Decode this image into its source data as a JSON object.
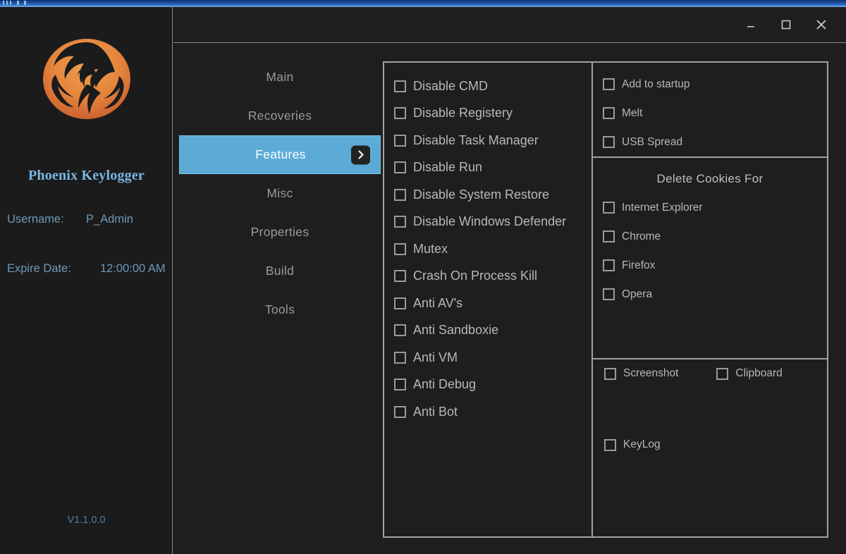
{
  "window": {
    "controls": [
      {
        "name": "minimize",
        "glyph": "minimize-icon"
      },
      {
        "name": "maximize",
        "glyph": "maximize-icon"
      },
      {
        "name": "close",
        "glyph": "close-icon"
      }
    ]
  },
  "sidebar": {
    "logo_alt": "phoenix-logo",
    "brand": "Phoenix Keylogger",
    "username_label": "Username:",
    "username_value": "P_Admin",
    "expire_label": "Expire Date:",
    "expire_value": "12:00:00 AM",
    "version": "V1.1.0.0"
  },
  "nav": {
    "items": [
      {
        "label": "Main",
        "active": false
      },
      {
        "label": "Recoveries",
        "active": false
      },
      {
        "label": "Features",
        "active": true
      },
      {
        "label": "Misc",
        "active": false
      },
      {
        "label": "Properties",
        "active": false
      },
      {
        "label": "Build",
        "active": false
      },
      {
        "label": "Tools",
        "active": false
      }
    ],
    "active_index": 2,
    "chevron_icon": "chevron-right-icon"
  },
  "features": {
    "left_column": [
      {
        "label": "Disable CMD",
        "checked": false
      },
      {
        "label": "Disable Registery",
        "checked": false
      },
      {
        "label": "Disable Task Manager",
        "checked": false
      },
      {
        "label": "Disable Run",
        "checked": false
      },
      {
        "label": "Disable System Restore",
        "checked": false
      },
      {
        "label": "Disable Windows Defender",
        "checked": false
      },
      {
        "label": "Mutex",
        "checked": false
      },
      {
        "label": "Crash On Process Kill",
        "checked": false
      },
      {
        "label": "Anti AV's",
        "checked": false
      },
      {
        "label": "Anti Sandboxie",
        "checked": false
      },
      {
        "label": "Anti VM",
        "checked": false
      },
      {
        "label": "Anti Debug",
        "checked": false
      },
      {
        "label": "Anti Bot",
        "checked": false
      }
    ],
    "startup_group": [
      {
        "label": "Add to startup",
        "checked": false
      },
      {
        "label": "Melt",
        "checked": false
      },
      {
        "label": "USB Spread",
        "checked": false
      }
    ],
    "cookies_title": "Delete Cookies For",
    "cookies_group": [
      {
        "label": "Internet Explorer",
        "checked": false
      },
      {
        "label": "Chrome",
        "checked": false
      },
      {
        "label": "Firefox",
        "checked": false
      },
      {
        "label": "Opera",
        "checked": false
      }
    ],
    "capture_group": [
      {
        "label": "Screenshot",
        "checked": false
      },
      {
        "label": "Clipboard",
        "checked": false
      }
    ],
    "keylog": {
      "label": "KeyLog",
      "checked": false
    }
  },
  "colors": {
    "accent_blue": "#5cabd7",
    "brand_text": "#79b8e0",
    "info_text": "#6d98b8",
    "panel_border": "#a2a2a2",
    "bg_dark": "#1e1e1e",
    "logo_orange": "#e8883a"
  }
}
